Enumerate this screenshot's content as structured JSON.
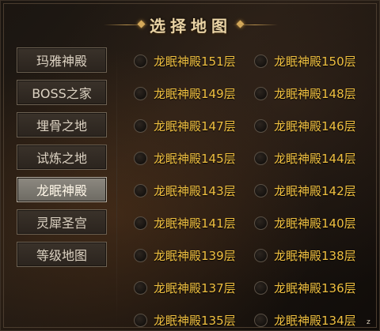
{
  "title": "选择地图",
  "sidebar": {
    "items": [
      {
        "label": "玛雅神殿",
        "active": false
      },
      {
        "label": "BOSS之家",
        "active": false
      },
      {
        "label": "埋骨之地",
        "active": false
      },
      {
        "label": "试炼之地",
        "active": false
      },
      {
        "label": "龙眠神殿",
        "active": true
      },
      {
        "label": "灵犀圣宫",
        "active": false
      },
      {
        "label": "等级地图",
        "active": false
      }
    ]
  },
  "levels": {
    "rows": [
      [
        "龙眠神殿151层",
        "龙眠神殿150层"
      ],
      [
        "龙眠神殿149层",
        "龙眠神殿148层"
      ],
      [
        "龙眠神殿147层",
        "龙眠神殿146层"
      ],
      [
        "龙眠神殿145层",
        "龙眠神殿144层"
      ],
      [
        "龙眠神殿143层",
        "龙眠神殿142层"
      ],
      [
        "龙眠神殿141层",
        "龙眠神殿140层"
      ],
      [
        "龙眠神殿139层",
        "龙眠神殿138层"
      ],
      [
        "龙眠神殿137层",
        "龙眠神殿136层"
      ],
      [
        "龙眠神殿135层",
        "龙眠神殿134层"
      ]
    ]
  },
  "scroll_handle_glyph": "z",
  "colors": {
    "accent_gold": "#f0c040",
    "active_tab": "#8d8980"
  }
}
